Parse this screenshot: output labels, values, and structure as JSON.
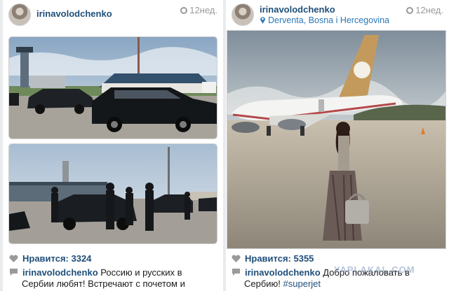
{
  "posts": [
    {
      "username": "irinavolodchenko",
      "time": "12нед.",
      "likes": "Нравится: 3324",
      "caption_user": "irinavolodchenko",
      "caption_line1": " Россию и русских в",
      "caption_line2": "Сербии любят! Встречают с почетом и"
    },
    {
      "username": "irinavolodchenko",
      "location": "Derventa, Bosna i Hercegovina",
      "time": "12нед.",
      "likes": "Нравится: 5355",
      "caption_user": "irinavolodchenko",
      "caption_line1": " Добро пожаловать в",
      "caption_line2": "Сербию! ",
      "caption_tag": "#superjet"
    }
  ],
  "watermark": "YAPLAKAL.COM",
  "colors": {
    "username": "#1f4e79",
    "location": "#2a78b8",
    "time": "#9a9a9a"
  },
  "icons": [
    "avatar",
    "clock-icon",
    "location-pin-icon",
    "heart-icon",
    "comment-icon"
  ]
}
